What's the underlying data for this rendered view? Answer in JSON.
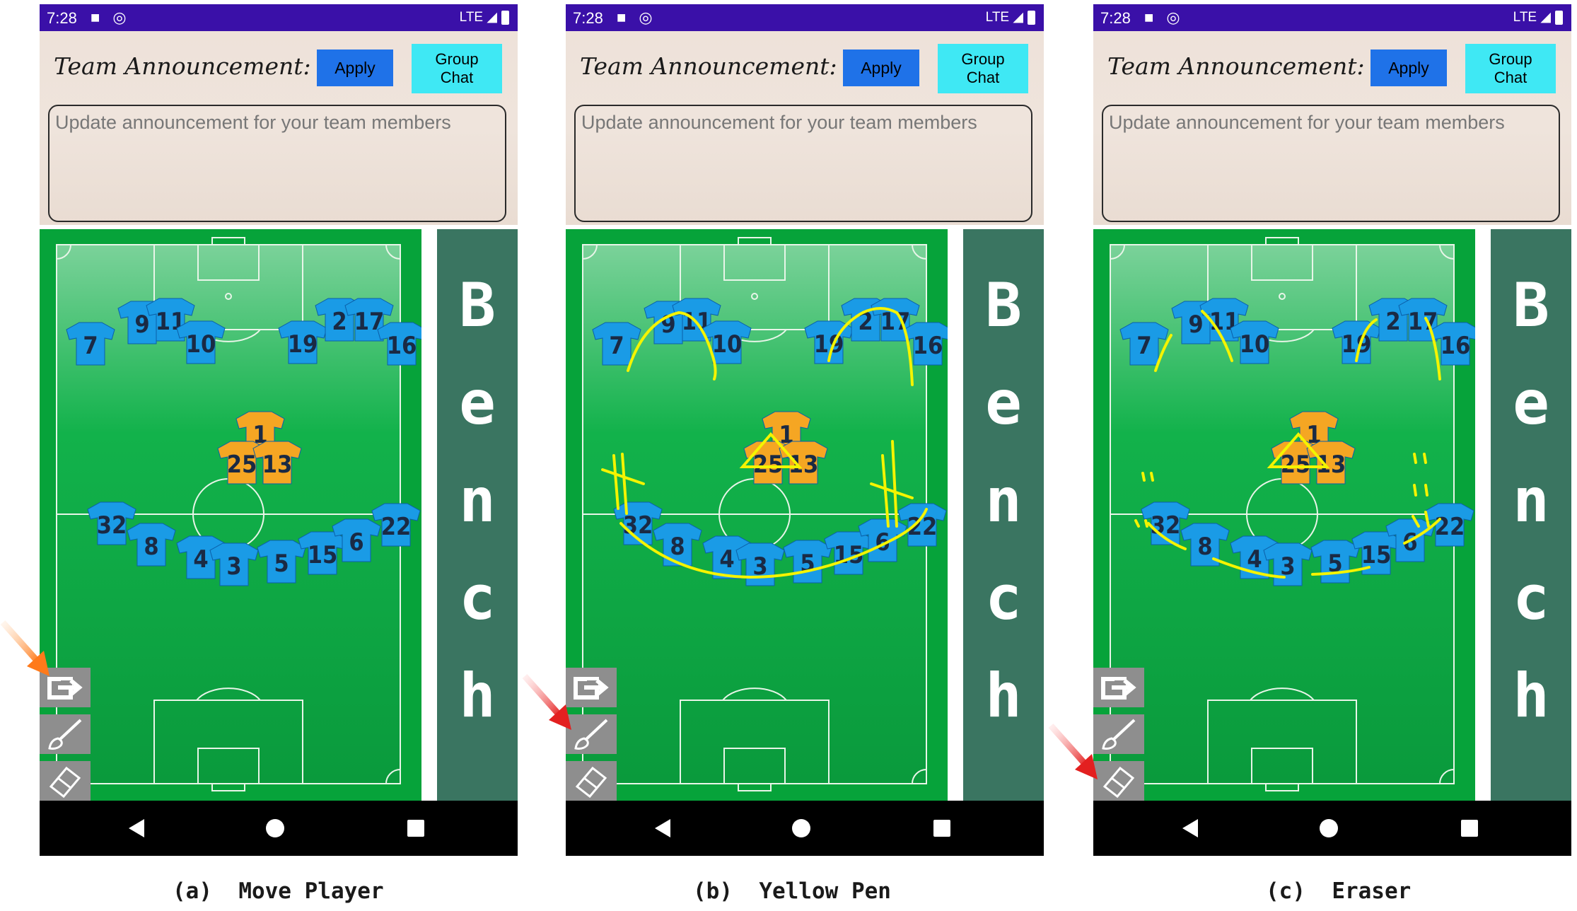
{
  "panels": [
    {
      "status": {
        "time": "7:28",
        "network": "LTE"
      },
      "header": {
        "label": "Team Announcement:",
        "apply": "Apply",
        "group_chat": "Group Chat"
      },
      "announcement": {
        "placeholder": "Update announcement for your team members"
      },
      "bench": [
        "B",
        "e",
        "n",
        "c",
        "h"
      ],
      "caption": "(a)  Move Player",
      "active_tool": "move-player"
    },
    {
      "status": {
        "time": "7:28",
        "network": "LTE"
      },
      "header": {
        "label": "Team Announcement:",
        "apply": "Apply",
        "group_chat": "Group Chat"
      },
      "announcement": {
        "placeholder": "Update announcement for your team members"
      },
      "bench": [
        "B",
        "e",
        "n",
        "c",
        "h"
      ],
      "caption": "(b)  Yellow Pen",
      "active_tool": "yellow-pen"
    },
    {
      "status": {
        "time": "7:28",
        "network": "LTE"
      },
      "header": {
        "label": "Team Announcement:",
        "apply": "Apply",
        "group_chat": "Group Chat"
      },
      "announcement": {
        "placeholder": "Update announcement for your team members"
      },
      "bench": [
        "B",
        "e",
        "n",
        "c",
        "h"
      ],
      "caption": "(c)  Eraser",
      "active_tool": "eraser"
    }
  ],
  "players": {
    "blue": [
      "7",
      "9",
      "11",
      "10",
      "19",
      "2",
      "17",
      "16",
      "32",
      "8",
      "4",
      "3",
      "5",
      "15",
      "6",
      "22"
    ],
    "orange": [
      "1",
      "25",
      "13"
    ]
  },
  "colors": {
    "status_bar": "#3a10a8",
    "apply": "#1f72e8",
    "group_chat": "#3fe8f4",
    "field": "#06a33a",
    "bench": "#3a7561",
    "blue_jersey": "#1a9be6",
    "orange_jersey": "#f5a623",
    "pen": "#f4f400"
  },
  "tools": [
    "share-arrow-icon",
    "paintbrush-icon",
    "eraser-icon"
  ]
}
